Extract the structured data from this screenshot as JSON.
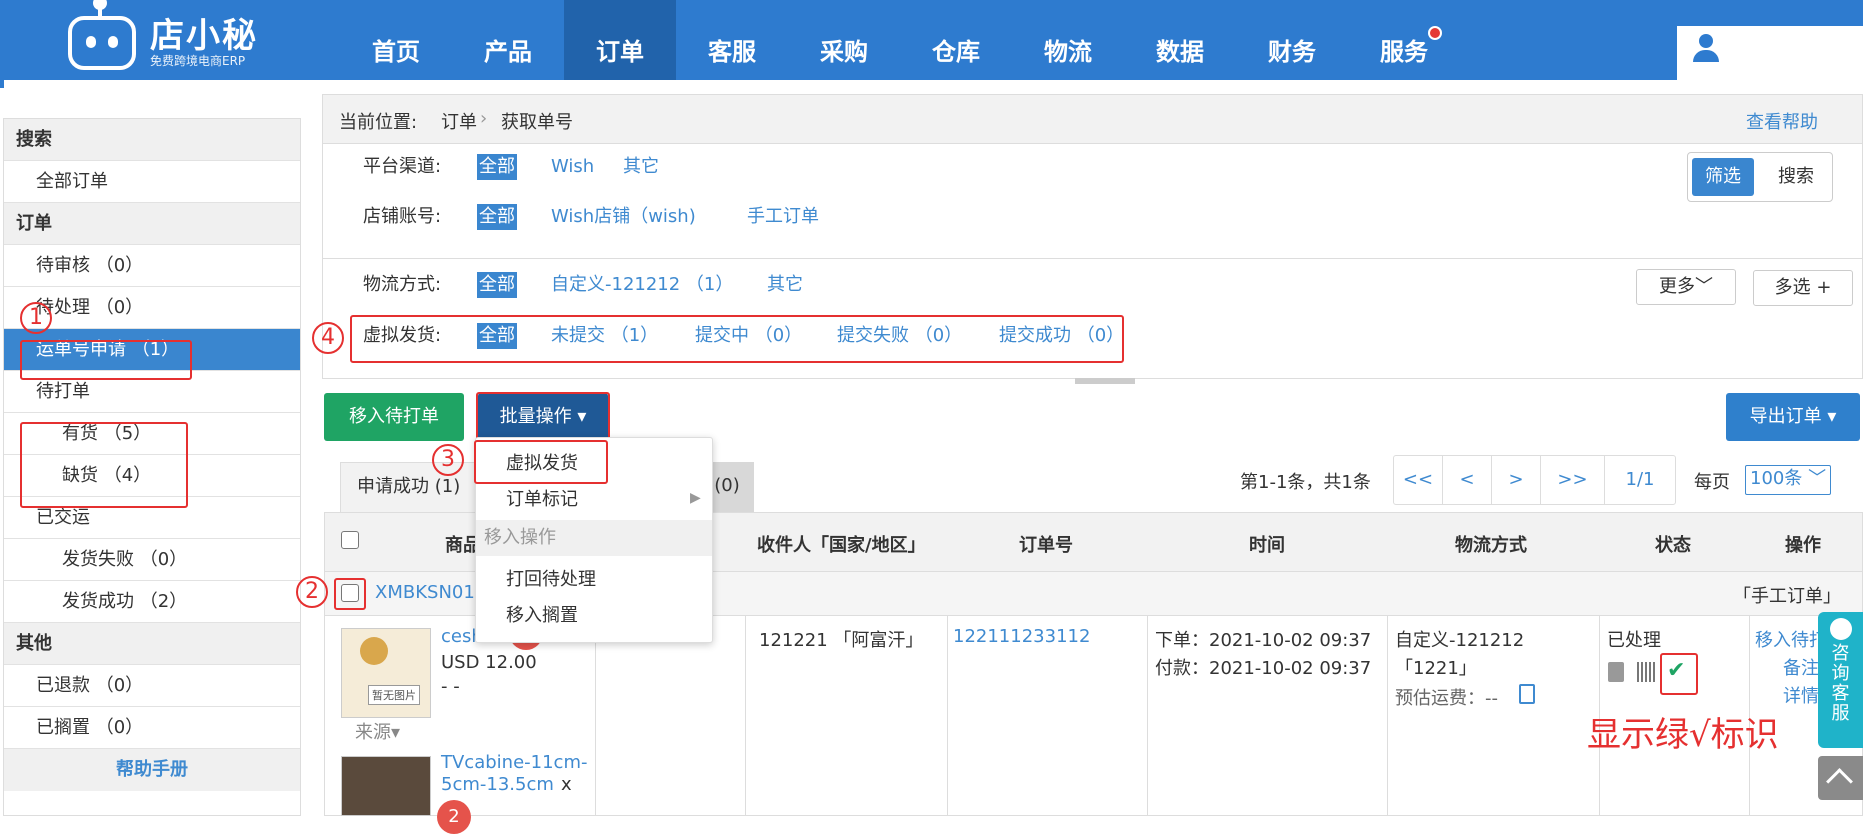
{
  "brand": {
    "name": "店小秘",
    "tagline": "免费跨境电商ERP"
  },
  "nav": [
    "首页",
    "产品",
    "订单",
    "客服",
    "采购",
    "仓库",
    "物流",
    "数据",
    "财务",
    "服务"
  ],
  "sidebar": {
    "search_header": "搜索",
    "all_orders": "全部订单",
    "order_header": "订单",
    "pending_review": "待审核 （0）",
    "pending_process": "待处理 （0）",
    "waybill_apply": "运单号申请 （1）",
    "pending_print": "待打单",
    "in_stock": "有货 （5）",
    "out_stock": "缺货 （4）",
    "shipped": "已交运",
    "ship_fail": "发货失败 （0）",
    "ship_success": "发货成功 （2）",
    "other_header": "其他",
    "refunded": "已退款 （0）",
    "shelved": "已搁置 （0）",
    "help_manual": "帮助手册"
  },
  "breadcrumb": {
    "label": "当前位置:",
    "level1": "订单",
    "sep": "›",
    "level2": "获取单号",
    "help": "查看帮助"
  },
  "filters": {
    "platform": {
      "label": "平台渠道:",
      "options": [
        "全部",
        "Wish",
        "其它"
      ]
    },
    "store": {
      "label": "店铺账号:",
      "options": [
        "全部",
        "Wish店铺（wish)",
        "手工订单"
      ]
    },
    "logistics": {
      "label": "物流方式:",
      "options": [
        "全部",
        "自定义-121212 （1）",
        "其它"
      ]
    },
    "virtual": {
      "label": "虚拟发货:",
      "options": [
        "全部",
        "未提交 （1）",
        "提交中 （0）",
        "提交失败 （0）",
        "提交成功 （0）"
      ]
    },
    "toggle_filter": "筛选",
    "toggle_search": "搜索",
    "more": "更多﹀",
    "multi": "多选 +"
  },
  "actions": {
    "move_to_print": "移入待打单",
    "batch": "批量操作 ▾",
    "export": "导出订单 ▾"
  },
  "tabs": {
    "success": "申请成功 (1)",
    "other_count": "(0)"
  },
  "pager": {
    "info": "第1-1条，共1条",
    "first": "<<",
    "prev": "<",
    "next": ">",
    "last": ">>",
    "page": "1/1",
    "per_page_label": "每页",
    "per_page": "100条 ﹀"
  },
  "table": {
    "headers": [
      "商品",
      "收件人「国家/地区」",
      "订单号",
      "时间",
      "物流方式",
      "状态",
      "操作"
    ],
    "group_code": "XMBKSN01",
    "group_tag": "「手工订单」",
    "row": {
      "product1_name": "cesh",
      "product1_price": "USD 12.00",
      "product1_dash": "- -",
      "product1_placeholder": "暂无图片",
      "source": "来源▾",
      "product2_name": "TVcabine-11cm-",
      "product2_name2": "5cm-13.5cm",
      "product2_x": "x",
      "badge2": "2",
      "recipient": "121221 「阿富汗」",
      "order_no": "122111233112",
      "time_order": "下单：2021-10-02 09:37",
      "time_pay": "付款：2021-10-02 09:37",
      "logistics1": "自定义-121212",
      "logistics2": "「1221」",
      "freight": "预估运费：--",
      "status": "已处理",
      "op1": "移入待打",
      "op2": "备注",
      "op3": "详情"
    }
  },
  "dropdown": {
    "virtual_ship": "虚拟发货",
    "order_mark": "订单标记",
    "move_ops": "移入操作",
    "back_to_process": "打回待处理",
    "move_to_shelf": "移入搁置"
  },
  "annotations": {
    "n1": "1",
    "n2": "2",
    "n3": "3",
    "n4": "4",
    "note": "显示绿√标识"
  },
  "float": {
    "chat": "咨询客服"
  }
}
